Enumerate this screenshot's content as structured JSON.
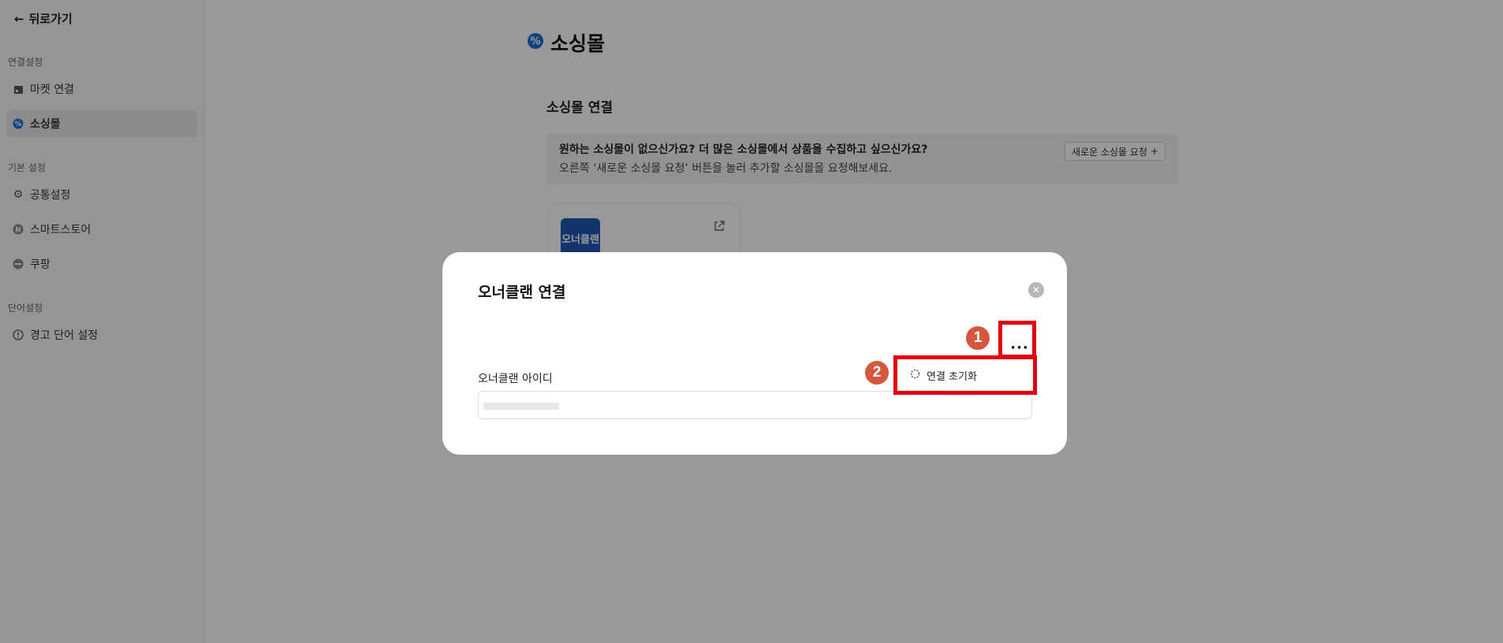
{
  "sidebar": {
    "back_label": "뒤로가기",
    "sections": [
      {
        "label": "연결설정",
        "items": [
          {
            "label": "마켓 연결",
            "icon": "store-icon"
          },
          {
            "label": "소싱몰",
            "icon": "badge-percent-icon",
            "active": true
          }
        ]
      },
      {
        "label": "기본 설정",
        "items": [
          {
            "label": "공통설정",
            "icon": "gear-icon"
          },
          {
            "label": "스마트스토어",
            "icon": "n-circle-icon"
          },
          {
            "label": "쿠팡",
            "icon": "coupang-icon"
          }
        ]
      },
      {
        "label": "단어설정",
        "items": [
          {
            "label": "경고 단어 설정",
            "icon": "info-circle-icon"
          }
        ]
      }
    ]
  },
  "page": {
    "title": "소싱몰",
    "card_title": "소싱몰 연결",
    "notice_line1": "원하는 소싱몰이 없으신가요? 더 많은 소싱몰에서 상품을 수집하고 싶으신가요?",
    "notice_line2": "오른쪽 ‘새로운 소싱몰 요청’ 버튼을 눌러 추가할 소싱몰을 요청해보세요.",
    "request_button": "새로운 소싱몰 요청",
    "request_button_icon": "+",
    "mall_logo_text": "오너클랜"
  },
  "modal": {
    "title": "오너클랜 연결",
    "more_label": "···",
    "field_label": "오너클랜 아이디",
    "menu_item": "연결 초기화"
  },
  "annotations": {
    "badge1": "1",
    "badge2": "2"
  },
  "colors": {
    "accent_blue": "#1e6fd9",
    "highlight_red": "#e0000f",
    "badge_orange": "#d6573c"
  }
}
